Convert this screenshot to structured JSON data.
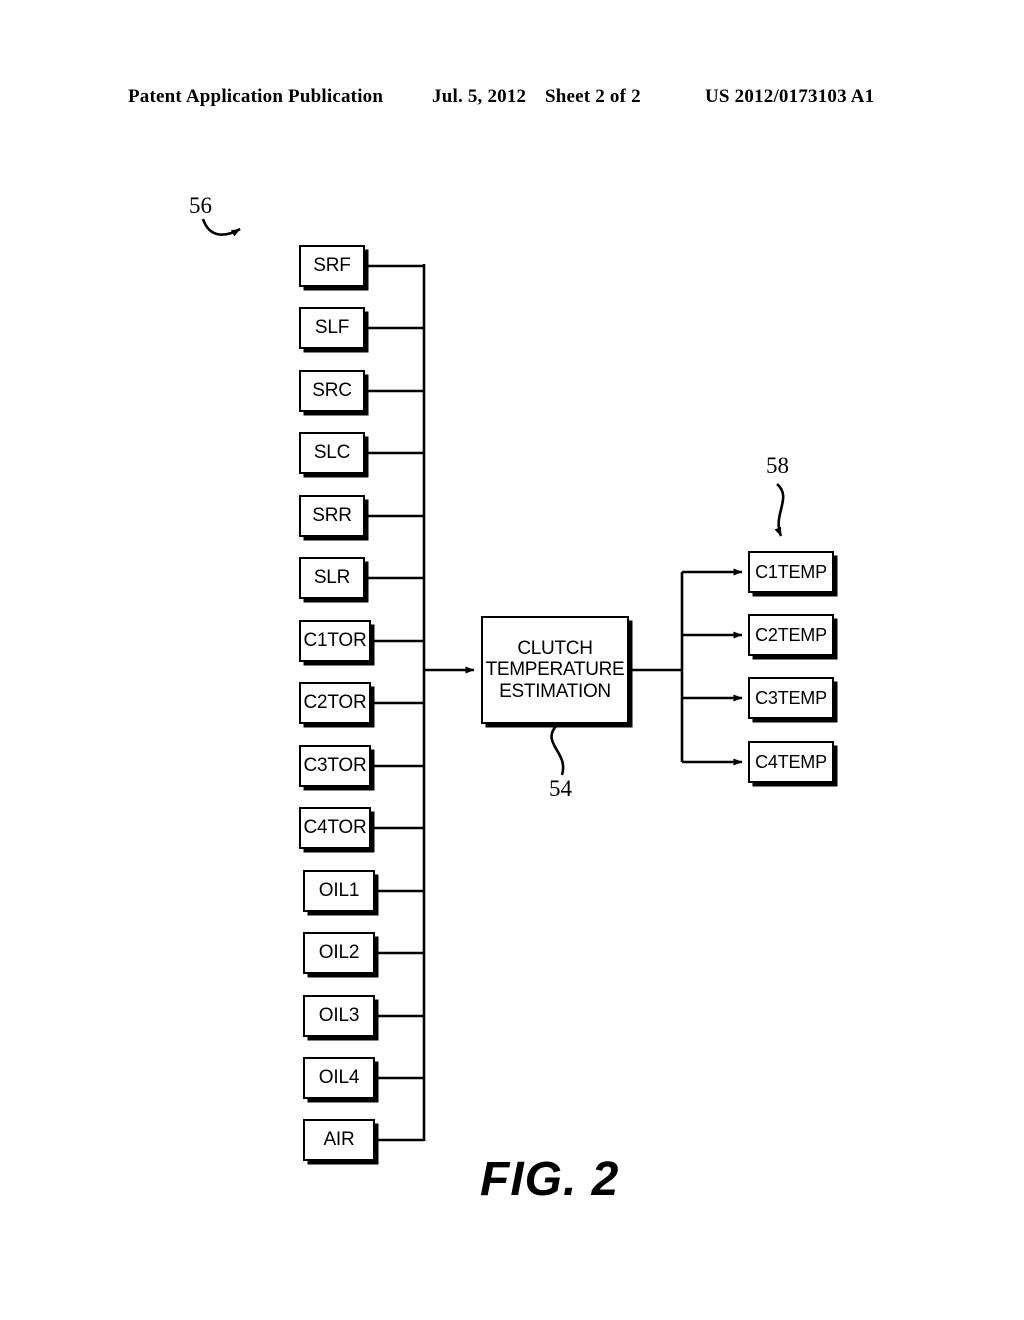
{
  "header": {
    "publication": "Patent Application Publication",
    "date": "Jul. 5, 2012",
    "sheet": "Sheet 2 of 2",
    "patent_number": "US 2012/0173103 A1"
  },
  "figure": {
    "caption": "FIG. 2",
    "reference_numerals": {
      "inputs_group": "56",
      "process_block": "54",
      "outputs_group": "58"
    },
    "process": {
      "label_lines": [
        "CLUTCH",
        "TEMPERATURE",
        "ESTIMATION"
      ],
      "line1": "CLUTCH",
      "line2": "TEMPERATURE",
      "line3": "ESTIMATION"
    },
    "inputs": [
      {
        "label": "SRF"
      },
      {
        "label": "SLF"
      },
      {
        "label": "SRC"
      },
      {
        "label": "SLC"
      },
      {
        "label": "SRR"
      },
      {
        "label": "SLR"
      },
      {
        "label": "C1TOR"
      },
      {
        "label": "C2TOR"
      },
      {
        "label": "C3TOR"
      },
      {
        "label": "C4TOR"
      },
      {
        "label": "OIL1"
      },
      {
        "label": "OIL2"
      },
      {
        "label": "OIL3"
      },
      {
        "label": "OIL4"
      },
      {
        "label": "AIR"
      }
    ],
    "outputs": [
      {
        "label": "C1TEMP"
      },
      {
        "label": "C2TEMP"
      },
      {
        "label": "C3TEMP"
      },
      {
        "label": "C4TEMP"
      }
    ],
    "colors": {
      "ink": "#000000",
      "paper": "#ffffff"
    }
  }
}
